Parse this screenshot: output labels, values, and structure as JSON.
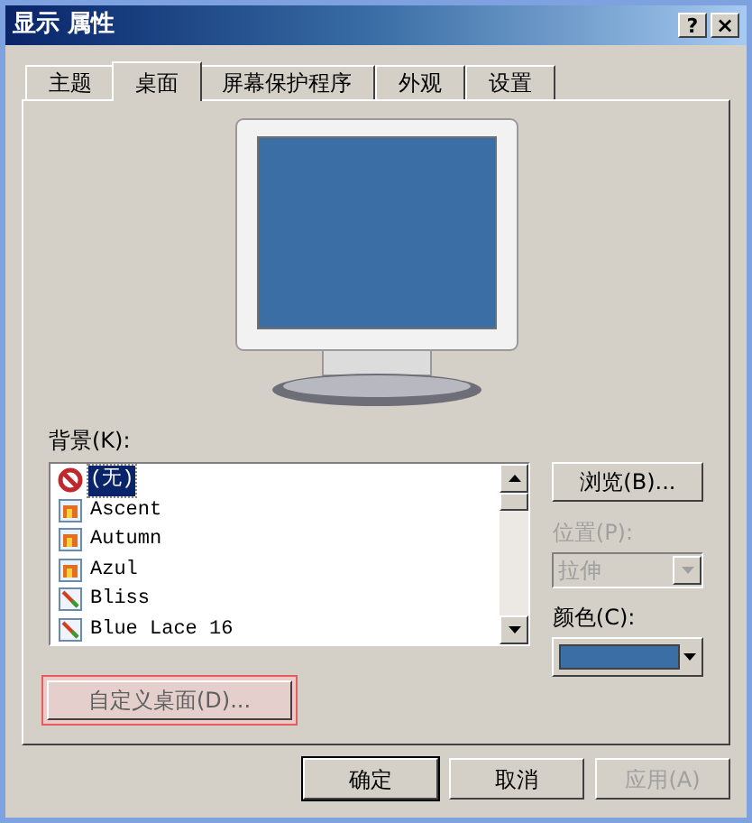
{
  "window": {
    "title": "显示 属性",
    "help_button": "?",
    "close_button": "×"
  },
  "tabs": [
    {
      "label": "主题",
      "selected": false
    },
    {
      "label": "桌面",
      "selected": true
    },
    {
      "label": "屏幕保护程序",
      "selected": false
    },
    {
      "label": "外观",
      "selected": false
    },
    {
      "label": "设置",
      "selected": false
    }
  ],
  "background": {
    "label": "背景(K):",
    "items": [
      {
        "label": "(无)",
        "kind": "none",
        "selected": true
      },
      {
        "label": "Ascent",
        "kind": "image",
        "selected": false
      },
      {
        "label": "Autumn",
        "kind": "image",
        "selected": false
      },
      {
        "label": "Azul",
        "kind": "image",
        "selected": false
      },
      {
        "label": "Bliss",
        "kind": "bitmap",
        "selected": false
      },
      {
        "label": "Blue Lace 16",
        "kind": "bitmap",
        "selected": false
      }
    ]
  },
  "browse_button": "浏览(B)...",
  "position": {
    "label": "位置(P):",
    "value": "拉伸",
    "disabled": true
  },
  "color": {
    "label": "颜色(C):",
    "color": "#3a6ea5"
  },
  "customize_button": {
    "label": "自定义桌面(D)...",
    "highlighted": true
  },
  "buttons": [
    {
      "label": "确定",
      "disabled": false,
      "default": true
    },
    {
      "label": "取消",
      "disabled": false,
      "default": false
    },
    {
      "label": "应用(A)",
      "disabled": true,
      "default": false
    }
  ]
}
